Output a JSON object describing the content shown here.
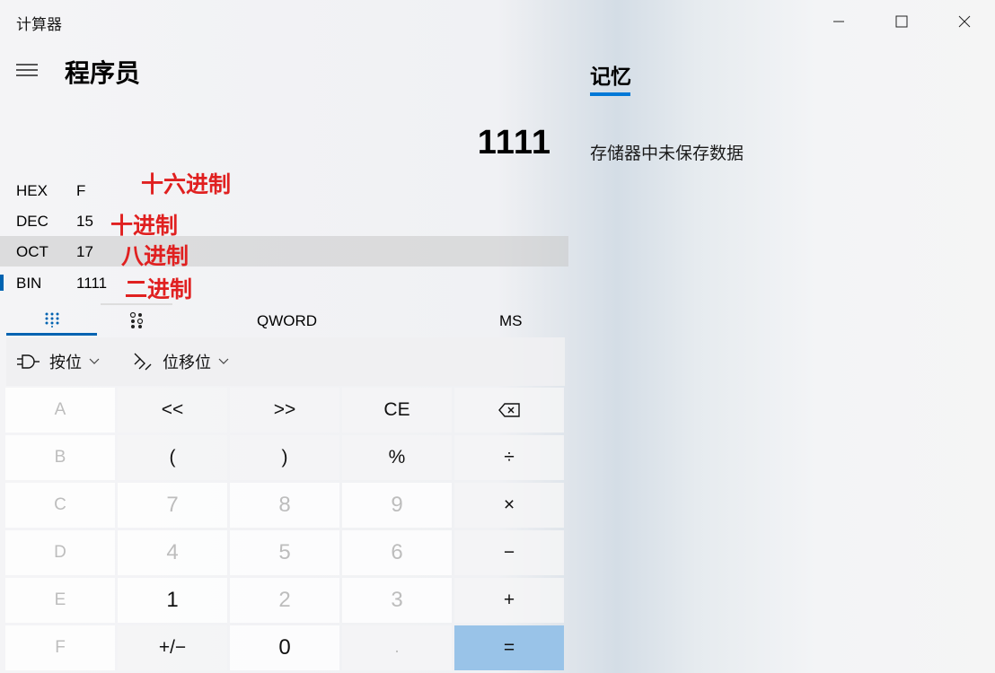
{
  "window": {
    "title": "计算器"
  },
  "header": {
    "mode": "程序员"
  },
  "display": {
    "value": "1111"
  },
  "radix": [
    {
      "name": "HEX",
      "value": "F",
      "annotation": "十六进制"
    },
    {
      "name": "DEC",
      "value": "15",
      "annotation": "十进制"
    },
    {
      "name": "OCT",
      "value": "17",
      "annotation": "八进制"
    },
    {
      "name": "BIN",
      "value": "1111",
      "annotation": "二进制"
    }
  ],
  "toolbar": {
    "word_size": "QWORD",
    "memory_store": "MS"
  },
  "ops": {
    "bitwise": "按位",
    "bitshift": "位移位"
  },
  "keys": {
    "r1": [
      "A",
      "<<",
      ">>",
      "CE",
      ""
    ],
    "r2": [
      "B",
      "(",
      ")",
      "%",
      "÷"
    ],
    "r3": [
      "C",
      "7",
      "8",
      "9",
      "×"
    ],
    "r4": [
      "D",
      "4",
      "5",
      "6",
      "−"
    ],
    "r5": [
      "E",
      "1",
      "2",
      "3",
      "+"
    ],
    "r6": [
      "F",
      "+/−",
      "0",
      ".",
      "="
    ]
  },
  "memory": {
    "title": "记忆",
    "empty_text": "存储器中未保存数据"
  },
  "colors": {
    "accent": "#0063b1",
    "annotation": "#e02020",
    "equals": "#99c3e8"
  }
}
